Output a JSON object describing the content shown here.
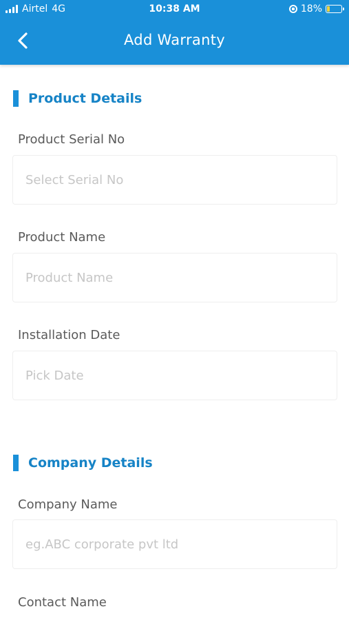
{
  "status_bar": {
    "carrier": "Airtel",
    "network": "4G",
    "time": "10:38 AM",
    "battery": "18%",
    "battery_level": 0.18
  },
  "header": {
    "title": "Add Warranty",
    "back_icon": "chevron-left-icon"
  },
  "sections": {
    "product": {
      "title": "Product Details",
      "serial_label": "Product Serial No",
      "serial_placeholder": "Select Serial No",
      "name_label": "Product Name",
      "name_placeholder": "Product Name",
      "date_label": "Installation Date",
      "date_placeholder": "Pick Date"
    },
    "company": {
      "title": "Company Details",
      "company_label": "Company Name",
      "company_placeholder": "eg.ABC corporate pvt ltd",
      "contact_label": "Contact Name"
    }
  },
  "colors": {
    "primary": "#1a90d9",
    "section_title": "#1683c6",
    "placeholder": "#c6c6c6"
  }
}
